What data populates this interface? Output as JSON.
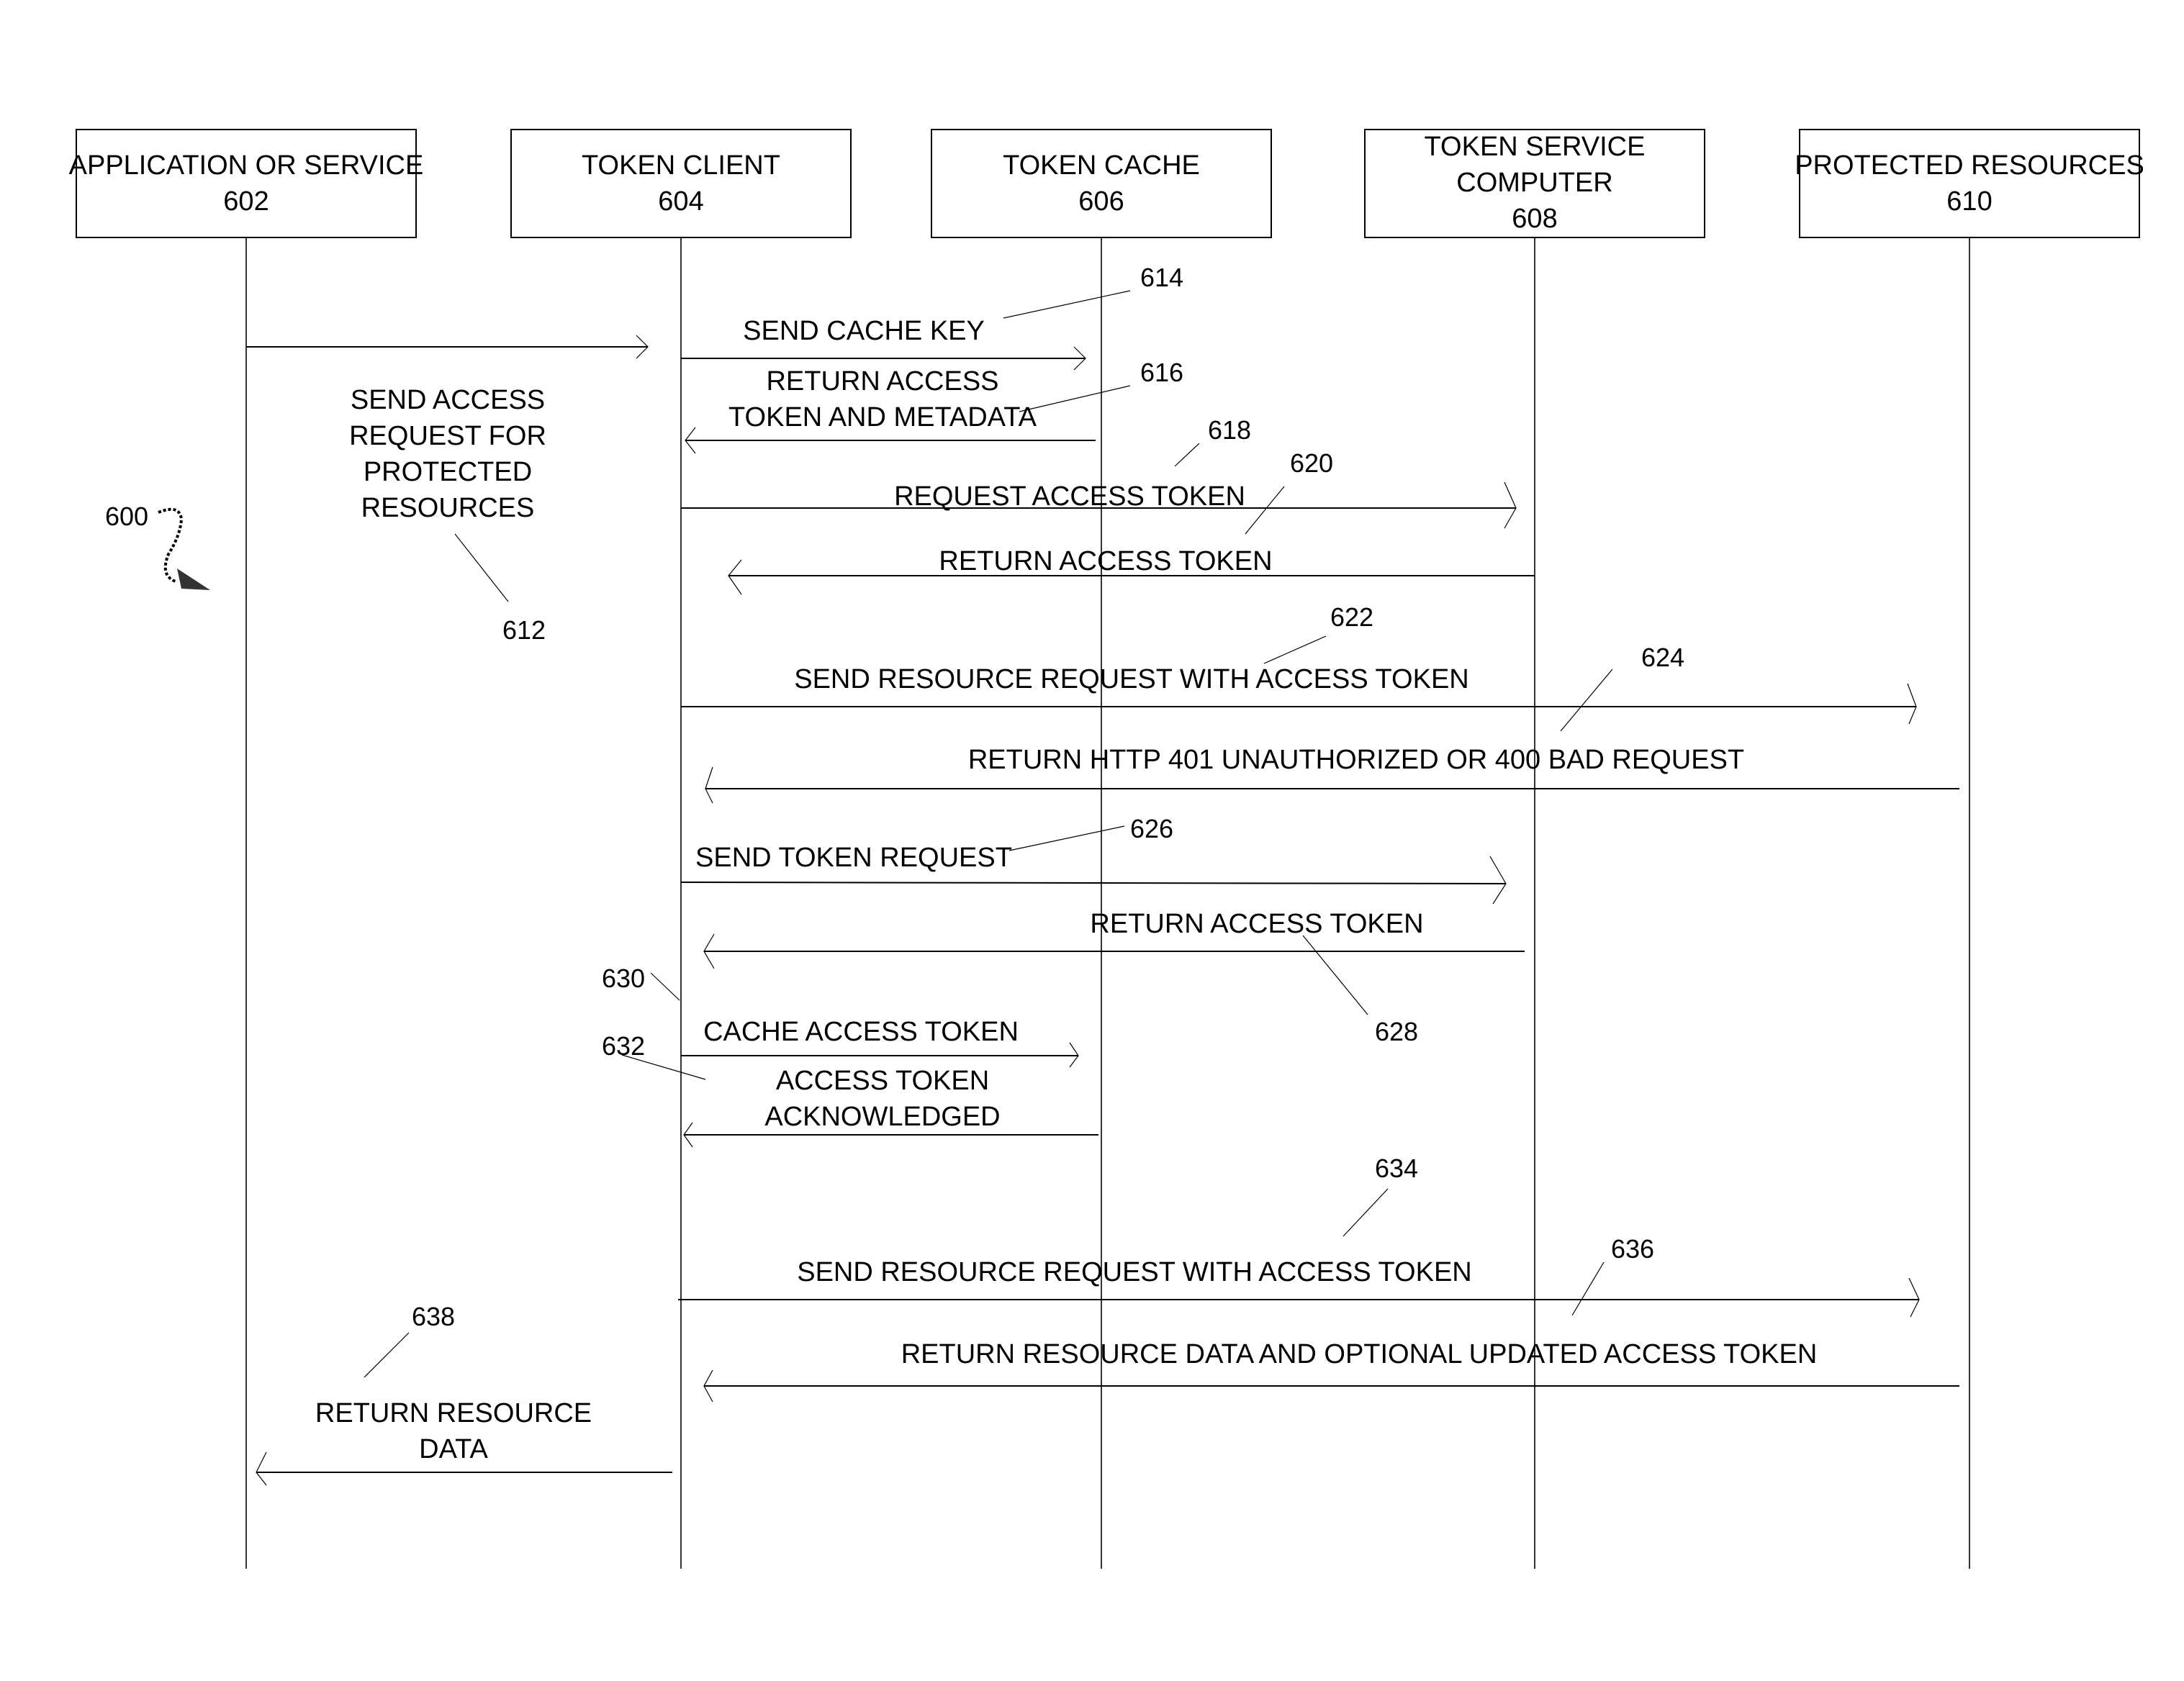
{
  "figure": {
    "ref": "600",
    "ref_arrow_icon": "squiggle-arrow-icon"
  },
  "participants": [
    {
      "id": "app",
      "name": "APPLICATION OR SERVICE",
      "ref": "602"
    },
    {
      "id": "client",
      "name": "TOKEN CLIENT",
      "ref": "604"
    },
    {
      "id": "cache",
      "name": "TOKEN CACHE",
      "ref": "606"
    },
    {
      "id": "service",
      "name": "TOKEN SERVICE COMPUTER",
      "name_lines": [
        "TOKEN SERVICE",
        "COMPUTER"
      ],
      "ref": "608"
    },
    {
      "id": "resources",
      "name": "PROTECTED RESOURCES",
      "ref": "610"
    }
  ],
  "messages": [
    {
      "ref": "612",
      "from": "app",
      "to": "client",
      "label_lines": [
        "SEND ACCESS",
        "REQUEST FOR",
        "PROTECTED",
        "RESOURCES"
      ]
    },
    {
      "ref": "614",
      "from": "client",
      "to": "cache",
      "label_lines": [
        "SEND CACHE KEY"
      ]
    },
    {
      "ref": "616",
      "from": "cache",
      "to": "client",
      "label_lines": [
        "RETURN ACCESS",
        "TOKEN AND METADATA"
      ]
    },
    {
      "ref": "618",
      "from": "client",
      "to": "service",
      "label_lines": [
        "REQUEST ACCESS TOKEN"
      ]
    },
    {
      "ref": "620",
      "from": "service",
      "to": "client",
      "label_lines": [
        "RETURN ACCESS TOKEN"
      ]
    },
    {
      "ref": "622",
      "from": "client",
      "to": "resources",
      "label_lines": [
        "SEND RESOURCE REQUEST WITH ACCESS TOKEN"
      ]
    },
    {
      "ref": "624",
      "from": "resources",
      "to": "client",
      "label_lines": [
        "RETURN HTTP 401 UNAUTHORIZED OR 400 BAD REQUEST"
      ]
    },
    {
      "ref": "626",
      "from": "client",
      "to": "service",
      "label_lines": [
        "SEND TOKEN REQUEST"
      ]
    },
    {
      "ref": "628",
      "from": "service",
      "to": "client",
      "label_lines": [
        "RETURN ACCESS TOKEN"
      ]
    },
    {
      "ref": "630",
      "from": "client",
      "to": "cache",
      "label_lines": [
        "CACHE ACCESS TOKEN"
      ]
    },
    {
      "ref": "632",
      "from": "cache",
      "to": "client",
      "label_lines": [
        "ACCESS TOKEN",
        "ACKNOWLEDGED"
      ]
    },
    {
      "ref": "634",
      "from": "client",
      "to": "resources",
      "label_lines": [
        "SEND RESOURCE REQUEST WITH ACCESS TOKEN"
      ]
    },
    {
      "ref": "636",
      "from": "resources",
      "to": "client",
      "label_lines": [
        "RETURN RESOURCE DATA AND OPTIONAL UPDATED ACCESS TOKEN"
      ]
    },
    {
      "ref": "638",
      "from": "client",
      "to": "app",
      "label_lines": [
        "RETURN RESOURCE",
        "DATA"
      ]
    }
  ]
}
